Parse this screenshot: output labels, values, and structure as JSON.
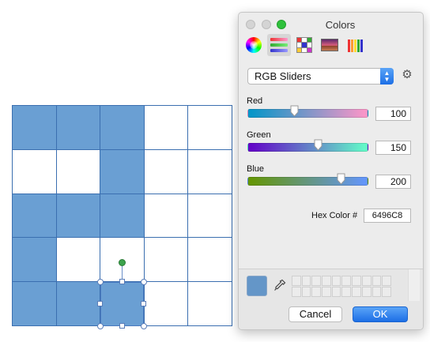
{
  "window": {
    "title": "Colors"
  },
  "toolbar": {
    "tabs": [
      {
        "icon": "color-wheel-icon",
        "selected": false
      },
      {
        "icon": "color-sliders-icon",
        "selected": true
      },
      {
        "icon": "color-palettes-icon",
        "selected": false
      },
      {
        "icon": "image-palettes-icon",
        "selected": false
      },
      {
        "icon": "pencils-icon",
        "selected": false
      }
    ]
  },
  "mode_select": {
    "value": "RGB Sliders"
  },
  "sliders": [
    {
      "label": "Red",
      "value": "100",
      "level": 0.392,
      "gradient_from": "#0096c8",
      "gradient_to": "#ff96c8"
    },
    {
      "label": "Green",
      "value": "150",
      "level": 0.588,
      "gradient_from": "#6400c8",
      "gradient_to": "#64ffc8"
    },
    {
      "label": "Blue",
      "value": "200",
      "level": 0.784,
      "gradient_from": "#649600",
      "gradient_to": "#6496ff"
    }
  ],
  "hex": {
    "label": "Hex Color #",
    "value": "6496C8"
  },
  "current_color": "#6496C8",
  "buttons": {
    "cancel": "Cancel",
    "ok": "OK"
  },
  "canvas": {
    "fill_color": "#6a9fd3",
    "columns": 5,
    "rows": 5,
    "filled": [
      [
        true,
        true,
        true,
        false,
        false
      ],
      [
        false,
        false,
        true,
        false,
        false
      ],
      [
        true,
        true,
        true,
        false,
        false
      ],
      [
        true,
        false,
        false,
        false,
        false
      ],
      [
        true,
        true,
        true,
        false,
        false
      ]
    ],
    "selected_cell": [
      4,
      2
    ]
  }
}
